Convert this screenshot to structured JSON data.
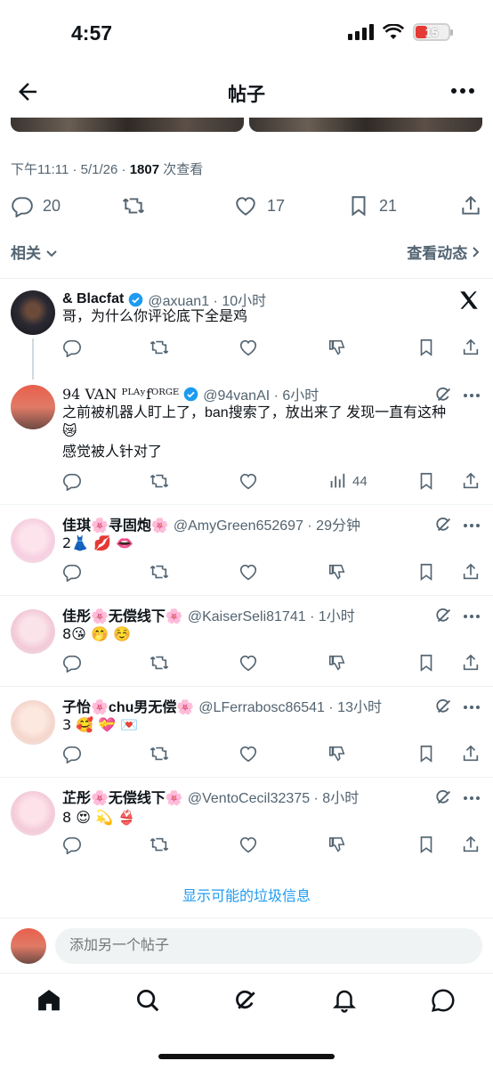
{
  "status": {
    "time": "4:57",
    "battery": "15"
  },
  "header": {
    "title": "帖子"
  },
  "post": {
    "date": "下午11:11 · 5/1/26 · ",
    "views_count": "1807",
    "views_label": " 次查看",
    "replies": "20",
    "reposts": "17",
    "likes": "",
    "bookmarks": "21",
    "likes_display": "17"
  },
  "related_label": "相关",
  "activity_label": "查看动态",
  "replies": [
    {
      "name": "& Blacfat",
      "handle": "@axuan1 · 10小时",
      "text": [
        "哥，为什么你评论底下全是鸡"
      ],
      "verified": true
    },
    {
      "name": "94 VAN ᴾᴸᴬʸfᴼᴿᴳᴱ",
      "handle": "@94vanAI · 6小时",
      "text": [
        "之前被机器人盯上了，ban搜索了，放出来了 发现一直有这种",
        "😿",
        "感觉被人针对了"
      ],
      "verified": true,
      "views": "44"
    },
    {
      "name": "佳琪🌸寻固炮🌸",
      "handle": "@AmyGreen652697 · 29分钟",
      "text": [
        "2👗 💋 👄"
      ]
    },
    {
      "name": "佳彤🌸无偿线下🌸",
      "handle": "@KaiserSeli81741 · 1小时",
      "text": [
        "8😘 🤭 ☺️"
      ]
    },
    {
      "name": "子怡🌸chu男无偿🌸",
      "handle": "@LFerrabosc86541 · 13小时",
      "text": [
        "3 🥰 💝 💌"
      ]
    },
    {
      "name": "芷彤🌸无偿线下🌸",
      "handle": "@VentoCecil32375 · 8小时",
      "text": [
        "8 😍 💫 👙"
      ]
    }
  ],
  "spam_link": "显示可能的垃圾信息",
  "compose": {
    "placeholder": "添加另一个帖子"
  },
  "colors": {
    "accent": "#1d9bf0",
    "verified": "#1d9bf0",
    "text": "#0f1419",
    "muted": "#536471"
  }
}
